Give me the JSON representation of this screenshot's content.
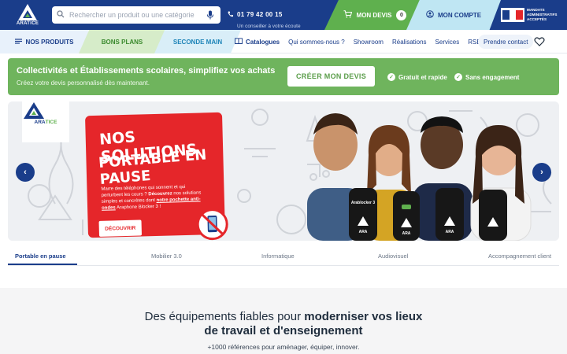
{
  "brand": {
    "name": "ARATICE",
    "name_part1": "ARA",
    "name_part2": "TICE",
    "colors": {
      "primary": "#1a3d8a",
      "green": "#5fb04e",
      "red": "#e5262a",
      "light_blue": "#bfe6f3"
    }
  },
  "header": {
    "search": {
      "placeholder": "Rechercher un produit ou une catégorie",
      "icon": "search-icon",
      "mic_icon": "microphone-icon"
    },
    "phone": {
      "number": "01 79 42 00 15",
      "subtitle": "Un conseiller à votre écoute",
      "icon": "phone-icon"
    },
    "devis": {
      "label": "MON DEVIS",
      "count": "0",
      "icon": "cart-icon"
    },
    "account": {
      "label": "MON COMPTE",
      "icon": "user-icon"
    },
    "mandats": {
      "line1": "MANDATS",
      "line2": "ADMINISTRATIFS",
      "line3": "ACCEPTÉS"
    }
  },
  "nav": {
    "products": "NOS PRODUITS",
    "bons_plans": "BONS PLANS",
    "seconde_main": "SECONDE MAIN",
    "links": {
      "catalogues": "Catalogues",
      "about": "Qui sommes-nous ?",
      "showroom": "Showroom",
      "realisations": "Réalisations",
      "services": "Services",
      "rse": "RSE"
    },
    "contact": "Prendre contact"
  },
  "promo": {
    "title": "Collectivités et Établissements scolaires, simplifiez vos achats",
    "subtitle": "Créez votre devis personnalisé dès maintenant.",
    "button": "CRÉER MON DEVIS",
    "features": [
      "Gratuit et rapide",
      "Sans engagement"
    ]
  },
  "hero": {
    "headline1": "NOS SOLUTIONS",
    "headline2": "PORTABLE EN PAUSE",
    "body_part1": "Marre des téléphones qui sonnent et qui perturbent les cours ? ",
    "body_highlight1": "Découvrez",
    "body_part2": " nos solutions simples et concrètes dont ",
    "body_highlight2": "notre pochette anti-ondes",
    "body_part3": " Araphone Blocker 3 !",
    "button": "DÉCOUVRIR",
    "pouch_labels": [
      "Arablocker 3",
      "ARA",
      "ARA",
      "ARA"
    ]
  },
  "tabs": [
    {
      "label": "Portable en pause",
      "active": true
    },
    {
      "label": "Mobilier 3.0",
      "active": false
    },
    {
      "label": "Informatique",
      "active": false
    },
    {
      "label": "Audiovisuel",
      "active": false
    },
    {
      "label": "Accompagnement client",
      "active": false
    }
  ],
  "section": {
    "title_part1": "Des équipements fiables pour ",
    "title_bold1": "moderniser vos lieux",
    "title_bold2": "de travail et d'enseignement",
    "subtitle": "+1000 références pour aménager, équiper, innover."
  }
}
